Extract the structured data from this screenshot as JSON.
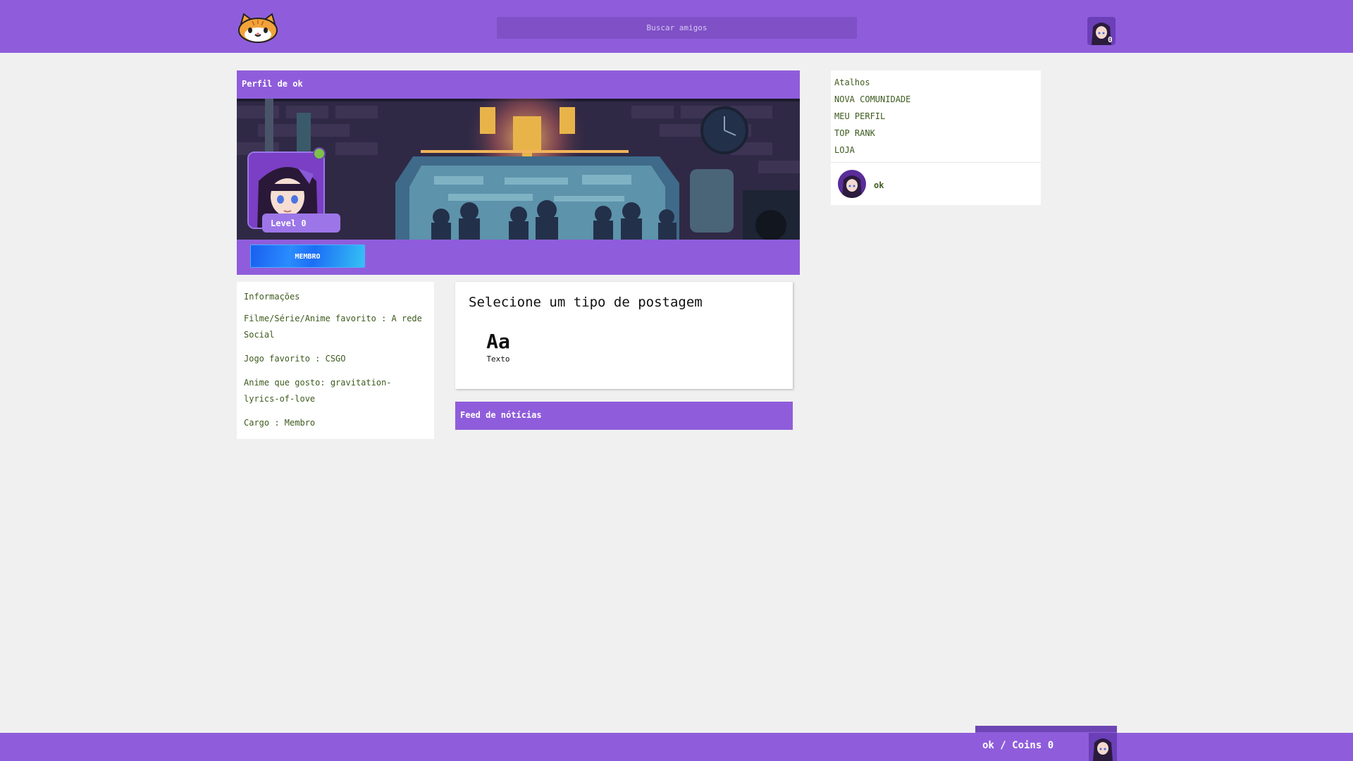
{
  "header": {
    "logo_icon": "cat-face-icon",
    "search_placeholder": "Buscar amigos",
    "notification_count": "0"
  },
  "profile": {
    "title": "Perfil de ok",
    "level_label": "Level 0",
    "badge_label": "MEMBRO",
    "status": "online"
  },
  "info": {
    "title": "Informações",
    "rows": [
      "Filme/Série/Anime favorito : A rede Social",
      "Jogo favorito : CSGO",
      "Anime que gosto: gravitation-lyrics-of-love",
      "Cargo : Membro"
    ]
  },
  "post": {
    "title": "Selecione um tipo de postagem",
    "types": [
      {
        "glyph": "Aa",
        "label": "Texto"
      }
    ]
  },
  "feed": {
    "title": "Feed de nótícias"
  },
  "shortcuts": {
    "title": "Atalhos",
    "items": [
      "NOVA COMUNIDADE",
      "MEU PERFIL",
      "TOP RANK",
      "LOJA"
    ],
    "username": "ok"
  },
  "footer": {
    "chat_label": "ok / Coins 0"
  },
  "colors": {
    "brand": "#8f5ddb",
    "text_green": "#3d5a1e",
    "online": "#7cc24a",
    "badge_blue": "#2a8cff"
  }
}
